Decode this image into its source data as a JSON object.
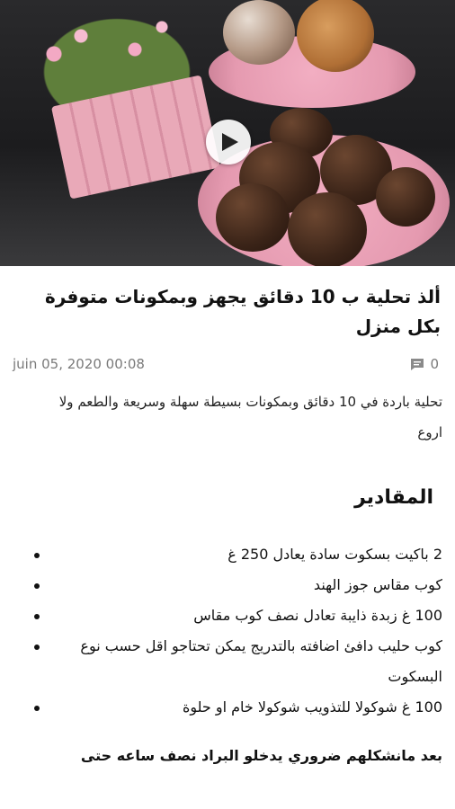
{
  "hero": {
    "play_icon": "play-icon"
  },
  "article": {
    "title": "ألذ تحلية ب 10 دقائق يجهز وبمكونات متوفرة بكل منزل",
    "date": "juin 05, 2020 00:08",
    "comment_count": "0",
    "comment_icon": "comment-icon",
    "description": "تحلية باردة في 10 دقائق وبمكونات بسيطة سهلة وسريعة والطعم ولا اروع",
    "section_title": "المقادير",
    "ingredients": [
      "2 باكيت بسكوت سادة يعادل 250 غ",
      "كوب مقاس جوز الهند",
      "100 غ زبدة ذايبة تعادل نصف كوب مقاس",
      "كوب حليب دافئ  اضافته بالتدريج يمكن تحتاجو اقل حسب نوع البسكوت",
      "100 غ شوكولا للتذويب شوكولا خام او حلوة"
    ],
    "paragraph": "بعد مانشكلهم ضروري يدخلو البراد نصف ساعه حتى"
  }
}
